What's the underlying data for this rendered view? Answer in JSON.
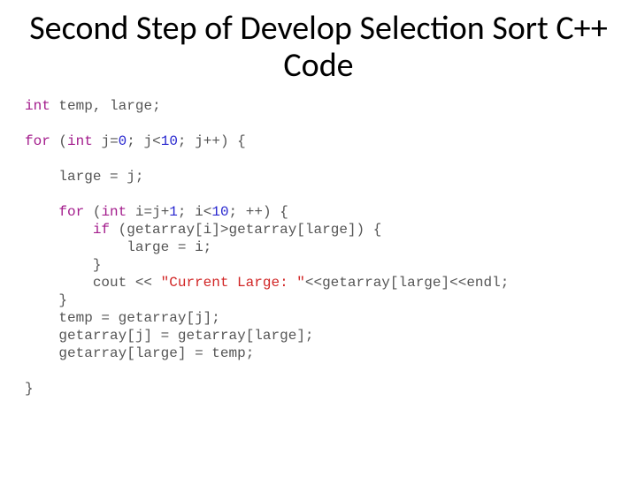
{
  "title": "Second Step of Develop Selection Sort C++ Code",
  "c": {
    "kw_int": "int",
    "kw_for": "for",
    "kw_if": "if",
    "temp": "temp",
    "large": "large",
    "j": "j",
    "i": "i",
    "cout": "cout",
    "getarray": "getarray",
    "endl": "endl",
    "zero": "0",
    "ten": "10",
    "one": "1",
    "eq": "=",
    "lt": "<",
    "gt": ">",
    "plusplus": "++",
    "plus": "+",
    "semicolon": ";",
    "comma": ",",
    "lparen": "(",
    "rparen": ")",
    "lbrace": "{",
    "rbrace": "}",
    "lbracket": "[",
    "rbracket": "]",
    "insert": "<<",
    "str_current_large": "\"Current Large: \""
  }
}
